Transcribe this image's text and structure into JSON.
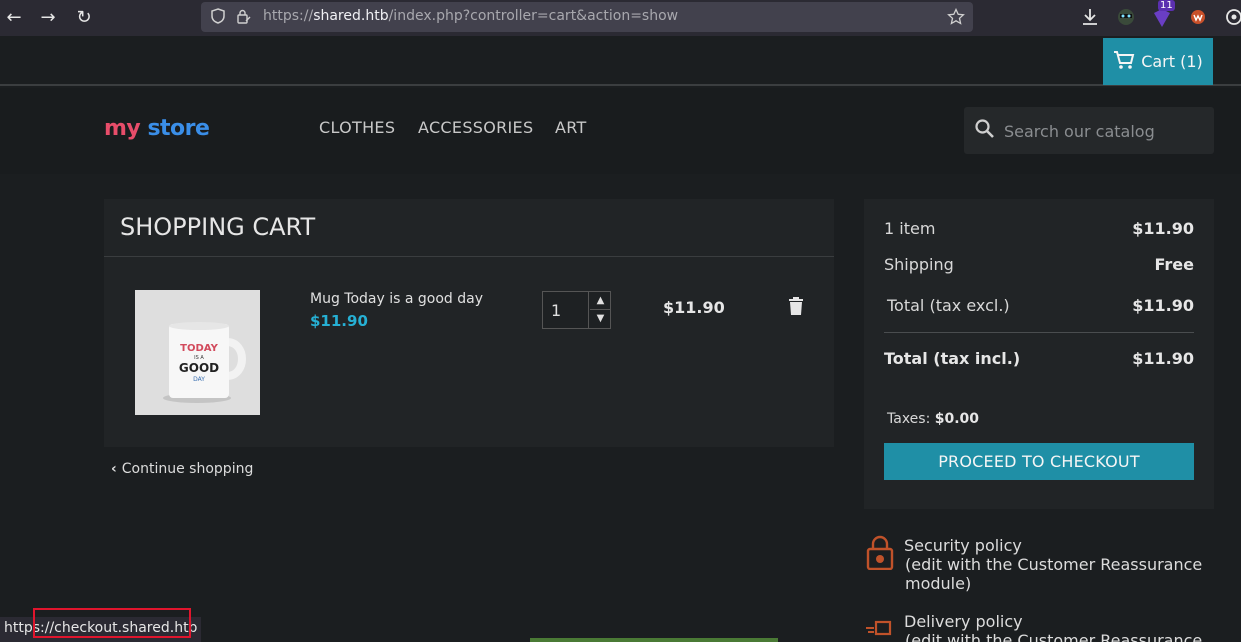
{
  "browser": {
    "url_scheme": "https://",
    "url_host": "shared.htb",
    "url_path": "/index.php?controller=cart&action=show",
    "extension_badge": "11",
    "status_bar_text": "https://checkout.shared.htb"
  },
  "topbar": {
    "cart_label": "Cart (1)"
  },
  "header": {
    "logo_part1": "my",
    "logo_part2": "store",
    "menu": [
      "CLOTHES",
      "ACCESSORIES",
      "ART"
    ],
    "search_placeholder": "Search our catalog"
  },
  "cart": {
    "title": "SHOPPING CART",
    "items": [
      {
        "name": "Mug Today is a good day",
        "price": "$11.90",
        "quantity": "1",
        "line_total": "$11.90",
        "image_text": [
          "TODAY",
          "IS A",
          "GOOD",
          "DAY"
        ]
      }
    ],
    "continue_label": "Continue shopping"
  },
  "summary": {
    "items_label": "1 item",
    "items_value": "$11.90",
    "shipping_label": "Shipping",
    "shipping_value": "Free",
    "total_excl_label": "Total (tax excl.)",
    "total_excl_value": "$11.90",
    "total_incl_label": "Total (tax incl.)",
    "total_incl_value": "$11.90",
    "taxes_label": "Taxes:",
    "taxes_value": "$0.00",
    "checkout_label": "PROCEED TO CHECKOUT"
  },
  "reassurance": [
    {
      "title": "Security policy",
      "sub": "(edit with the Customer Reassurance module)"
    },
    {
      "title": "Delivery policy",
      "sub": "(edit with the Customer Reassurance"
    }
  ],
  "colors": {
    "accent": "#1f8fa6",
    "price": "#26b0d4",
    "reassurance_icon": "#c0522a",
    "status_highlight": "#e0152d"
  }
}
